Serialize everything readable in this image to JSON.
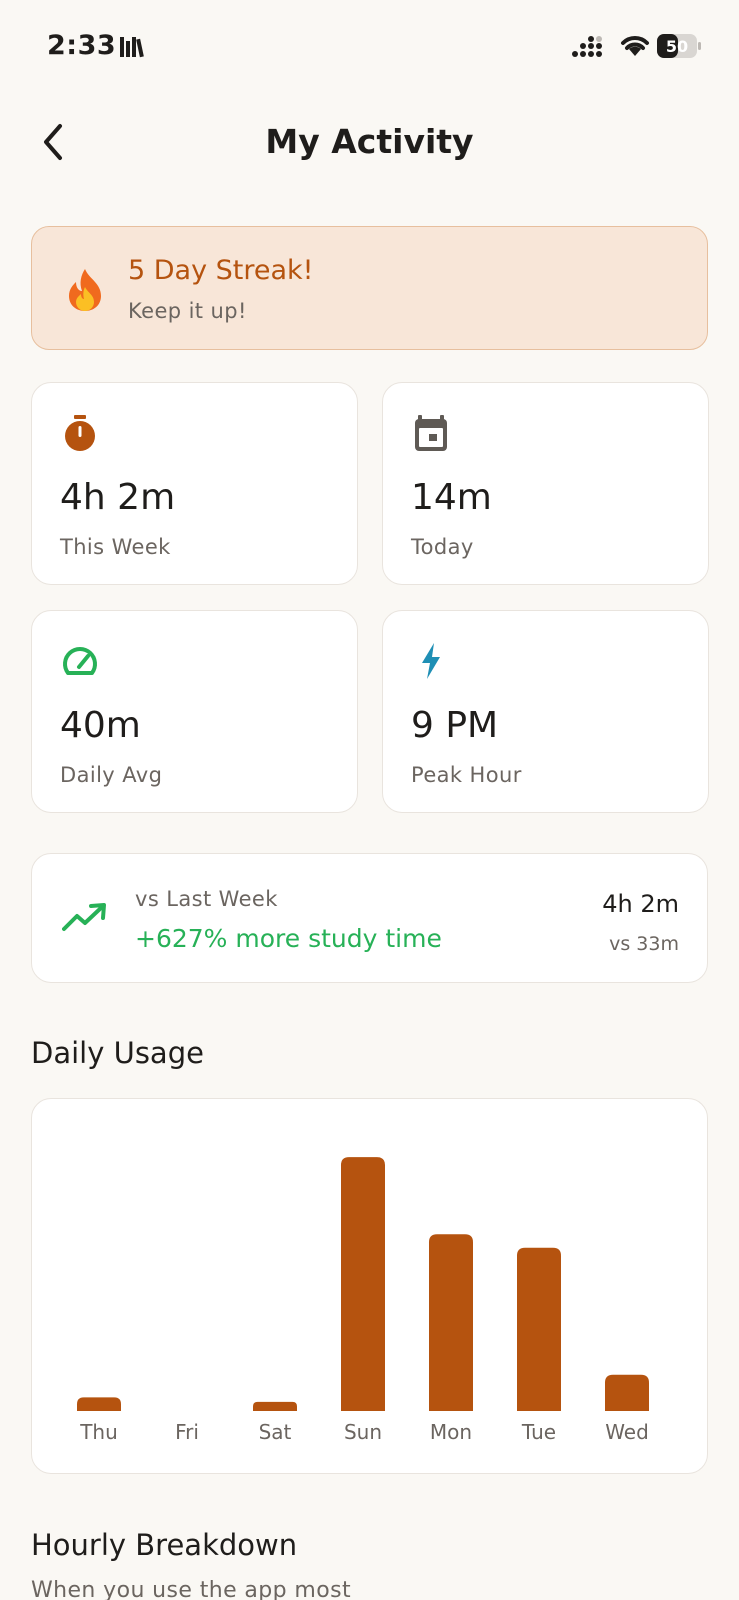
{
  "status_bar": {
    "time": "2:33",
    "battery": "50"
  },
  "header": {
    "title": "My Activity"
  },
  "streak": {
    "title": "5 Day Streak!",
    "subtitle": "Keep it up!"
  },
  "stats": [
    {
      "value": "4h 2m",
      "label": "This Week",
      "icon": "stopwatch-icon",
      "color": "#b5530f"
    },
    {
      "value": "14m",
      "label": "Today",
      "icon": "calendar-icon",
      "color": "#5f5a55"
    },
    {
      "value": "40m",
      "label": "Daily Avg",
      "icon": "speedometer-icon",
      "color": "#27b157"
    },
    {
      "value": "9 PM",
      "label": "Peak Hour",
      "icon": "lightning-icon",
      "color": "#1f8fb5"
    }
  ],
  "comparison": {
    "caption": "vs Last Week",
    "change": "+627% more study time",
    "current": "4h 2m",
    "previous": "vs 33m"
  },
  "daily_usage": {
    "title": "Daily Usage"
  },
  "chart_data": {
    "type": "bar",
    "categories": [
      "Thu",
      "Fri",
      "Sat",
      "Sun",
      "Mon",
      "Tue",
      "Wed"
    ],
    "values": [
      3,
      0,
      2,
      56,
      39,
      36,
      8
    ],
    "unit": "minutes",
    "ylim": [
      0,
      60
    ],
    "color": "#b5530f",
    "grid": false
  },
  "hourly": {
    "title": "Hourly Breakdown",
    "subtitle": "When you use the app most"
  },
  "colors": {
    "accent": "#b5530f",
    "positive": "#27b157",
    "background": "#faf8f4"
  }
}
